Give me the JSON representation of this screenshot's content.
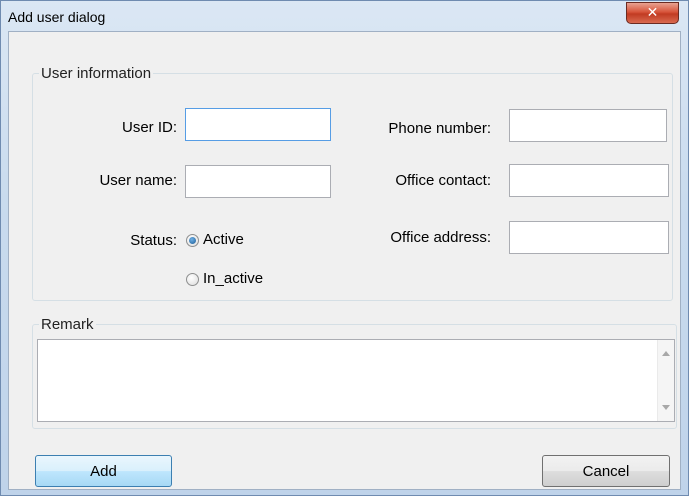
{
  "window": {
    "title": "Add user dialog",
    "close_glyph": "✕"
  },
  "user_info": {
    "legend": "User information",
    "user_id_label": "User ID:",
    "user_id_value": "",
    "user_name_label": "User name:",
    "user_name_value": "",
    "status_label": "Status:",
    "status_options": [
      "Active",
      "In_active"
    ],
    "status_selected": "Active",
    "phone_label": "Phone number:",
    "phone_value": "",
    "office_contact_label": "Office contact:",
    "office_contact_value": "",
    "office_address_label": "Office address:",
    "office_address_value": ""
  },
  "remark": {
    "legend": "Remark",
    "value": ""
  },
  "buttons": {
    "add": "Add",
    "cancel": "Cancel"
  },
  "colors": {
    "accent_focus": "#569de5",
    "close_button": "#c13b22"
  },
  "icons": {
    "close": "close-icon",
    "scroll_up": "scroll-up-arrow-icon",
    "scroll_down": "scroll-down-arrow-icon"
  }
}
